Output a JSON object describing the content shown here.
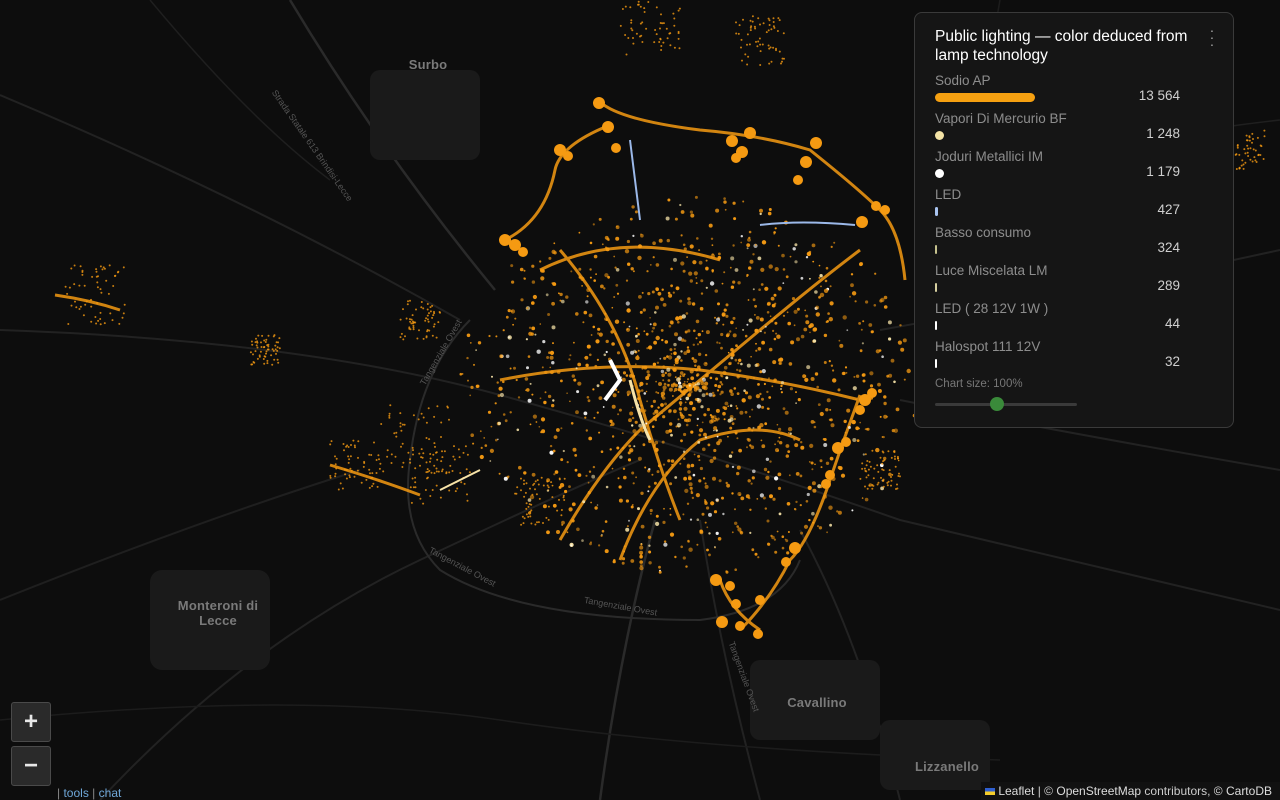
{
  "map": {
    "towns": [
      {
        "id": "surbo",
        "name": "Surbo"
      },
      {
        "id": "monteroni",
        "name": "Monteroni di Lecce"
      },
      {
        "id": "cavallino",
        "name": "Cavallino"
      },
      {
        "id": "lizzanello",
        "name": "Lizzanello"
      }
    ],
    "road_labels": [
      {
        "id": "ss613",
        "text": "Strada Statale 613 Brindisi-Lecce"
      },
      {
        "id": "tang-ovest-1",
        "text": "Tangenziale Ovest"
      },
      {
        "id": "tang-ovest-2",
        "text": "Tangenziale Ovest"
      },
      {
        "id": "tang-ovest-3",
        "text": "Tangenziale Ovest"
      },
      {
        "id": "tang-ovest-4",
        "text": "Tangenziale Ovest"
      }
    ],
    "colors": {
      "background": "#0d0d0d",
      "road": "#262626",
      "sodio_ap": "#f59a12",
      "mercurio": "#f7e3a8",
      "joduri": "#ffffff",
      "led": "#9bb8e8",
      "basso": "#c9c98a"
    }
  },
  "panel": {
    "title": "Public lighting — color deduced from lamp technology",
    "menu_icon": "vertical-dots-icon",
    "legend": [
      {
        "label": "Sodio AP",
        "count": "13 564",
        "value": 13564,
        "color": "#f5a011"
      },
      {
        "label": "Vapori Di Mercurio BF",
        "count": "1 248",
        "value": 1248,
        "color": "#f3e2a5"
      },
      {
        "label": "Joduri Metallici IM",
        "count": "1 179",
        "value": 1179,
        "color": "#ffffff"
      },
      {
        "label": "LED",
        "count": "427",
        "value": 427,
        "color": "#a9c4f0"
      },
      {
        "label": "Basso consumo",
        "count": "324",
        "value": 324,
        "color": "#c6c28e"
      },
      {
        "label": "Luce Miscelata LM",
        "count": "289",
        "value": 289,
        "color": "#d6cfa0"
      },
      {
        "label": "LED ( 28 12V 1W )",
        "count": "44",
        "value": 44,
        "color": "#ffffff"
      },
      {
        "label": "Halospot 111 12V",
        "count": "32",
        "value": 32,
        "color": "#ffffff"
      }
    ],
    "chart_size_label": "Chart size: 100%",
    "chart_size_value": 1.0
  },
  "controls": {
    "zoom_in": "+",
    "zoom_out": "−",
    "tools": "tools",
    "sep": "|",
    "chat": "chat"
  },
  "attribution": {
    "leaflet": "Leaflet",
    "sep": "|",
    "copyright": "©",
    "osm": "OpenStreetMap",
    "contributors": "contributors,",
    "carto": "© CartoDB"
  }
}
